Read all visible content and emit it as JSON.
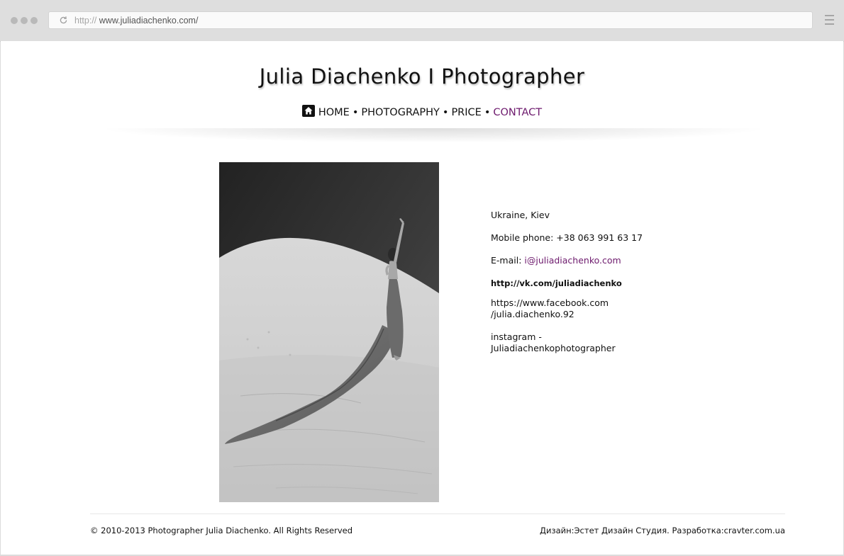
{
  "browser": {
    "url_protocol": "http://",
    "url_host": "www.juliadiachenko.com/"
  },
  "site": {
    "title": "Julia Diachenko  I  Photographer"
  },
  "nav": {
    "items": [
      {
        "label": "HOME"
      },
      {
        "label": "PHOTOGRAPHY"
      },
      {
        "label": "PRICE"
      },
      {
        "label": "CONTACT"
      }
    ],
    "separator": "•",
    "active": "CONTACT",
    "active_color": "#6d1a6d"
  },
  "photo": {
    "icon": "photo-bw-woman-dune"
  },
  "contact": {
    "location": "Ukraine, Kiev",
    "phone_label": "Mobile phone: ",
    "phone": "+38 063 991 63 17",
    "email_label": "E-mail: ",
    "email": "i@juliadiachenko.com",
    "vk": "http://vk.com/juliadiachenko",
    "facebook_line1": "https://www.facebook.com",
    "facebook_line2": "/julia.diachenko.92",
    "instagram_line1": "instagram -",
    "instagram_line2": "Juliadiachenkophotographer"
  },
  "footer": {
    "copyright": "© 2010-2013 Photographer Julia Diachenko. All Rights Reserved",
    "design_label": "Дизайн:",
    "design_studio": "Эстет Дизайн Студия",
    "dev_label": ". Разработка:",
    "dev_site": "cravter.com.ua"
  }
}
